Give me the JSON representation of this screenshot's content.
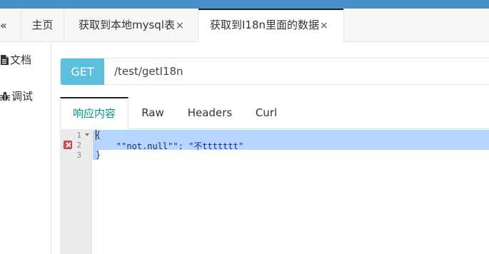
{
  "tabs": {
    "collapse": "«",
    "home": "主页",
    "mysql": "获取到本地mysql表",
    "i18n": "获取到I18n里面的数据",
    "close": "×"
  },
  "sidebar": {
    "docs": "文档",
    "debug": "调试"
  },
  "request": {
    "method": "GET",
    "url": "/test/getI18n"
  },
  "response_tabs": [
    "响应内容",
    "Raw",
    "Headers",
    "Curl"
  ],
  "editor": {
    "line_numbers": [
      "1",
      "2",
      "3"
    ],
    "line1": "{",
    "line2_key": "\"\"not.null\"\"",
    "line2_sep": ": ",
    "line2_value": "\"不ttttttt\"",
    "line3": "}"
  },
  "colors": {
    "top_bar": "#4a90c8",
    "method_badge": "#5bc0de",
    "active_tab_text": "#009688",
    "selection": "#b5d5ff",
    "error_marker": "#d9534f"
  }
}
